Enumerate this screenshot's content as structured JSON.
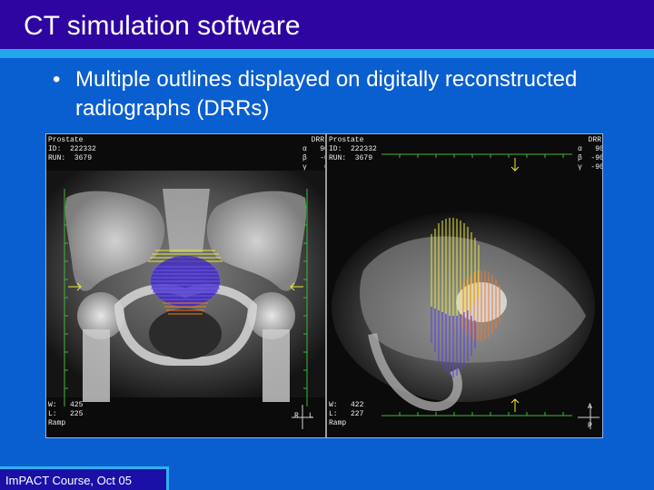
{
  "slide": {
    "title": "CT simulation software",
    "bullet": "Multiple outlines displayed on digitally reconstructed radiographs (DRRs)",
    "footer": "ImPACT Course, Oct 05"
  },
  "viewer": {
    "left_pane": {
      "header_left": "Prostate\nID:  222332\nRUN:  3679",
      "header_right": "DRR\nα   90\nβ   -0\nγ    0",
      "footer_left": "W:   425\nL:   225\nRamp",
      "orient_r": "R",
      "orient_l": "L"
    },
    "right_pane": {
      "header_left": "Prostate\nID:  222332\nRUN:  3679",
      "header_right": "DRR\nα   90\nβ  -90\nγ  -90",
      "footer_left": "W:   422\nL:   227\nRamp",
      "orient_a": "A",
      "orient_p": "P"
    }
  },
  "colors": {
    "slide_bg": "#0a5fd0",
    "header_bg": "#2e05a0",
    "accent": "#22a6ee",
    "outline_yellow": "#e8e83a",
    "outline_blue": "#5a3ee0",
    "outline_orange": "#f07a2a",
    "ruler_green": "#3cb83c"
  }
}
